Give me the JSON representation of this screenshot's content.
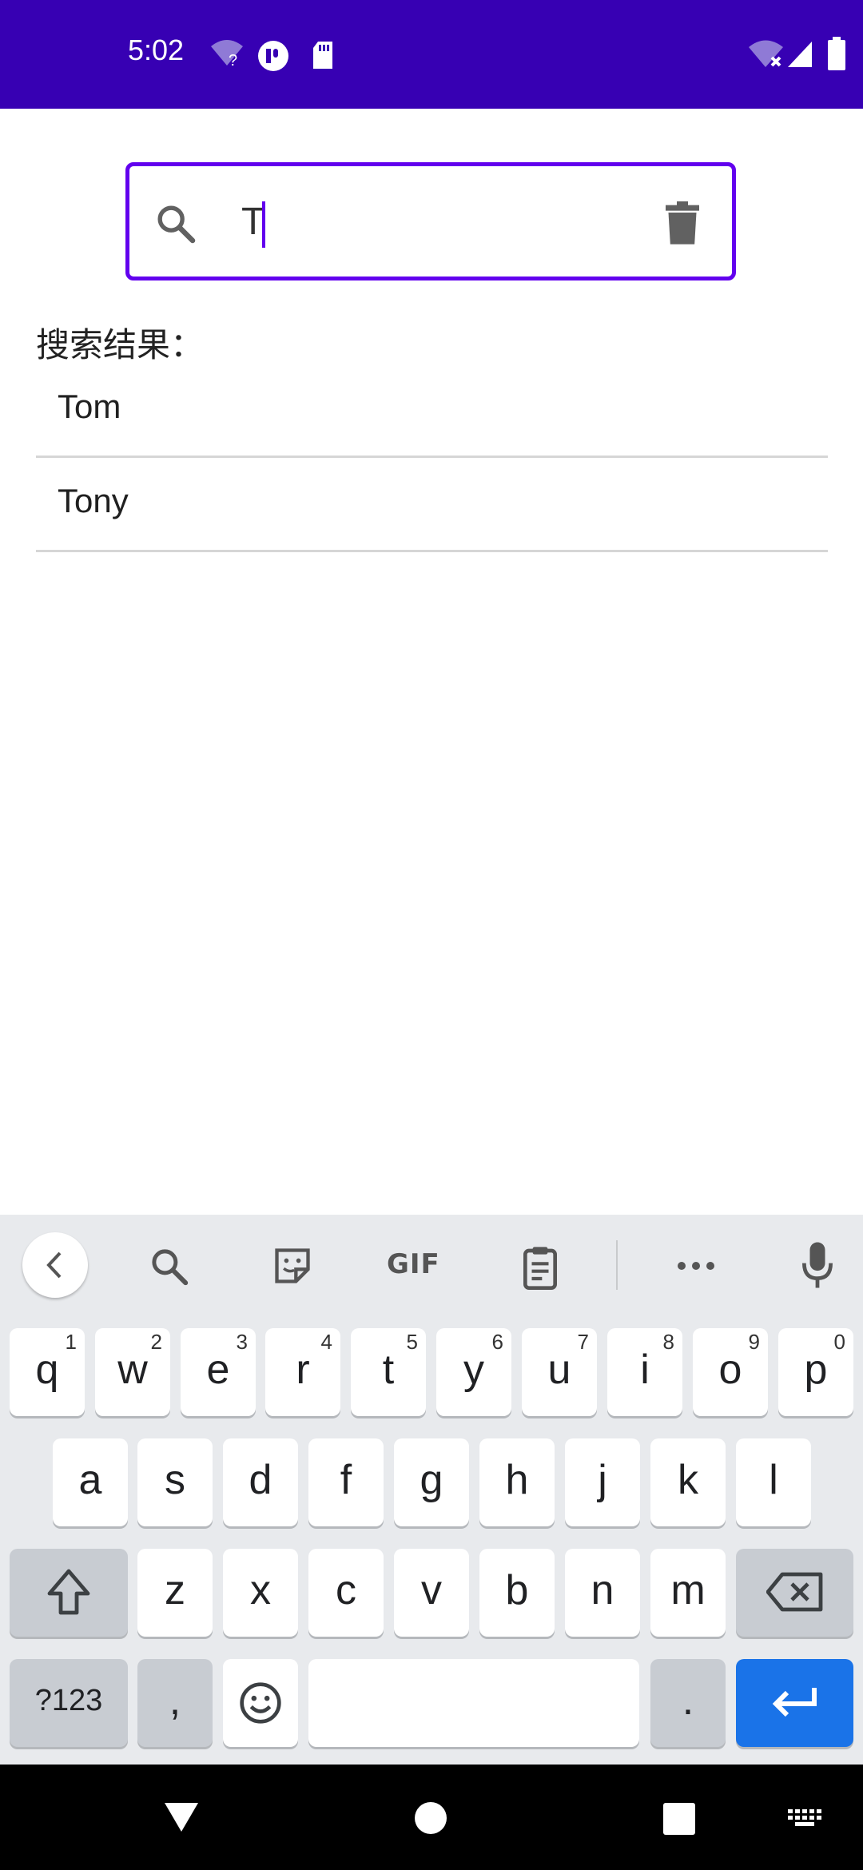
{
  "status_bar": {
    "time": "5:02",
    "icons": [
      "wifi-question-icon",
      "app-notification-icon",
      "sd-card-icon",
      "wifi-off-icon",
      "cell-signal-icon",
      "battery-icon"
    ]
  },
  "search": {
    "value": "T",
    "search_icon": "search-icon",
    "clear_icon": "delete-icon"
  },
  "results": {
    "label": "搜索结果：",
    "items": [
      "Tom",
      "Tony"
    ]
  },
  "keyboard": {
    "toolbar": {
      "gif_label": "GIF",
      "icons": [
        "back-icon",
        "search-icon",
        "sticker-icon",
        "clipboard-icon",
        "more-icon",
        "mic-icon"
      ]
    },
    "row1": [
      {
        "k": "q",
        "h": "1"
      },
      {
        "k": "w",
        "h": "2"
      },
      {
        "k": "e",
        "h": "3"
      },
      {
        "k": "r",
        "h": "4"
      },
      {
        "k": "t",
        "h": "5"
      },
      {
        "k": "y",
        "h": "6"
      },
      {
        "k": "u",
        "h": "7"
      },
      {
        "k": "i",
        "h": "8"
      },
      {
        "k": "o",
        "h": "9"
      },
      {
        "k": "p",
        "h": "0"
      }
    ],
    "row2": [
      "a",
      "s",
      "d",
      "f",
      "g",
      "h",
      "j",
      "k",
      "l"
    ],
    "row3": [
      "z",
      "x",
      "c",
      "v",
      "b",
      "n",
      "m"
    ],
    "row4": {
      "symbols": "?123",
      "comma": ",",
      "period": "."
    }
  },
  "colors": {
    "status_bar": "#3700b3",
    "accent": "#6200ee",
    "enter_key": "#1a73e8"
  }
}
